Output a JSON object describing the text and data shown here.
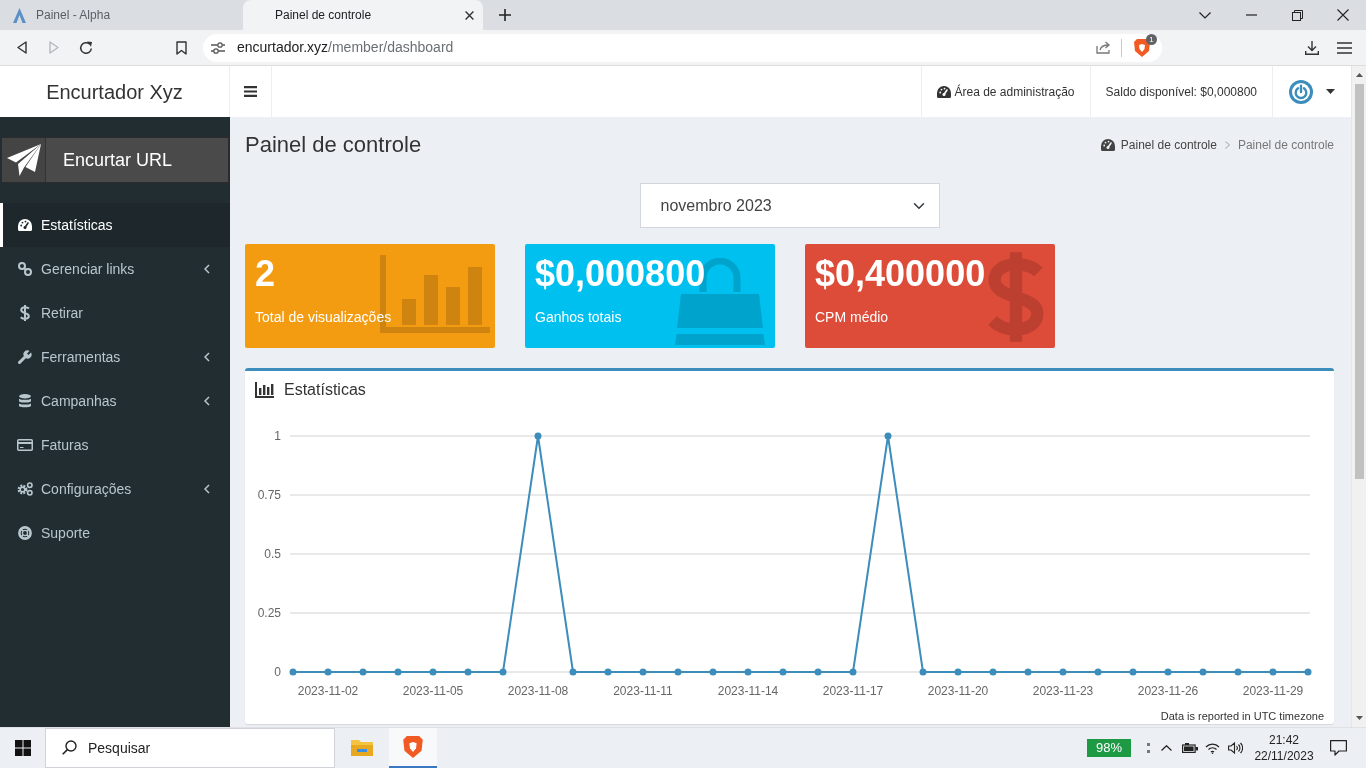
{
  "browser": {
    "tabs": [
      {
        "title": "Painel - Alpha",
        "selected": false
      },
      {
        "title": "Painel de controle",
        "selected": true
      }
    ],
    "forward_disabled": true,
    "address": {
      "host": "encurtador.xyz",
      "path": "/member/dashboard"
    },
    "shields_count": "1"
  },
  "header": {
    "brand": "Encurtador Xyz",
    "admin_link": "Área de administração",
    "balance": "Saldo disponível: $0,000800"
  },
  "sidebar": {
    "shorten_button": "Encurtar URL",
    "items": [
      {
        "label": "Estatísticas",
        "selected": true,
        "has_submenu": false
      },
      {
        "label": "Gerenciar links",
        "selected": false,
        "has_submenu": true
      },
      {
        "label": "Retirar",
        "selected": false,
        "has_submenu": false
      },
      {
        "label": "Ferramentas",
        "selected": false,
        "has_submenu": true
      },
      {
        "label": "Campanhas",
        "selected": false,
        "has_submenu": true
      },
      {
        "label": "Faturas",
        "selected": false,
        "has_submenu": false
      },
      {
        "label": "Configurações",
        "selected": false,
        "has_submenu": true
      },
      {
        "label": "Suporte",
        "selected": false,
        "has_submenu": false
      }
    ]
  },
  "page": {
    "title": "Painel de controle",
    "breadcrumb": [
      {
        "label": "Painel de controle",
        "selected": false
      },
      {
        "label": "Painel de controle",
        "selected": true
      }
    ],
    "month_select": "novembro 2023"
  },
  "stat_cards": [
    {
      "value": "2",
      "label": "Total de visualizações",
      "color": "#f39c12"
    },
    {
      "value": "$0,000800",
      "label": "Ganhos totais",
      "color": "#00c0ef"
    },
    {
      "value": "$0,400000",
      "label": "CPM médio",
      "color": "#dd4b39"
    }
  ],
  "statistics": {
    "title": "Estatísticas",
    "chart_data": {
      "type": "line",
      "categories": [
        null,
        "2023-11-02",
        null,
        null,
        "2023-11-05",
        null,
        null,
        "2023-11-08",
        null,
        null,
        "2023-11-11",
        null,
        null,
        "2023-11-14",
        null,
        null,
        "2023-11-17",
        null,
        null,
        "2023-11-20",
        null,
        null,
        "2023-11-23",
        null,
        null,
        "2023-11-26",
        null,
        null,
        "2023-11-29",
        null
      ],
      "values": [
        0,
        0,
        0,
        0,
        0,
        0,
        0,
        1,
        0,
        0,
        0,
        0,
        0,
        0,
        0,
        0,
        0,
        1,
        0,
        0,
        0,
        0,
        0,
        0,
        0,
        0,
        0,
        0,
        0,
        0
      ],
      "color": "#3c8dbc",
      "ylim": [
        0,
        1
      ],
      "yticks": [
        0,
        0.25,
        0.5,
        0.75,
        1
      ],
      "grid": true,
      "marker": "circle"
    },
    "note": "Data is reported in UTC timezone"
  },
  "taskbar": {
    "search_placeholder": "Pesquisar",
    "apps": [
      {
        "kind": "folder",
        "selected": false
      },
      {
        "kind": "browser",
        "selected": true
      }
    ],
    "battery": "98%",
    "time": "21:42",
    "date": "22/11/2023"
  }
}
